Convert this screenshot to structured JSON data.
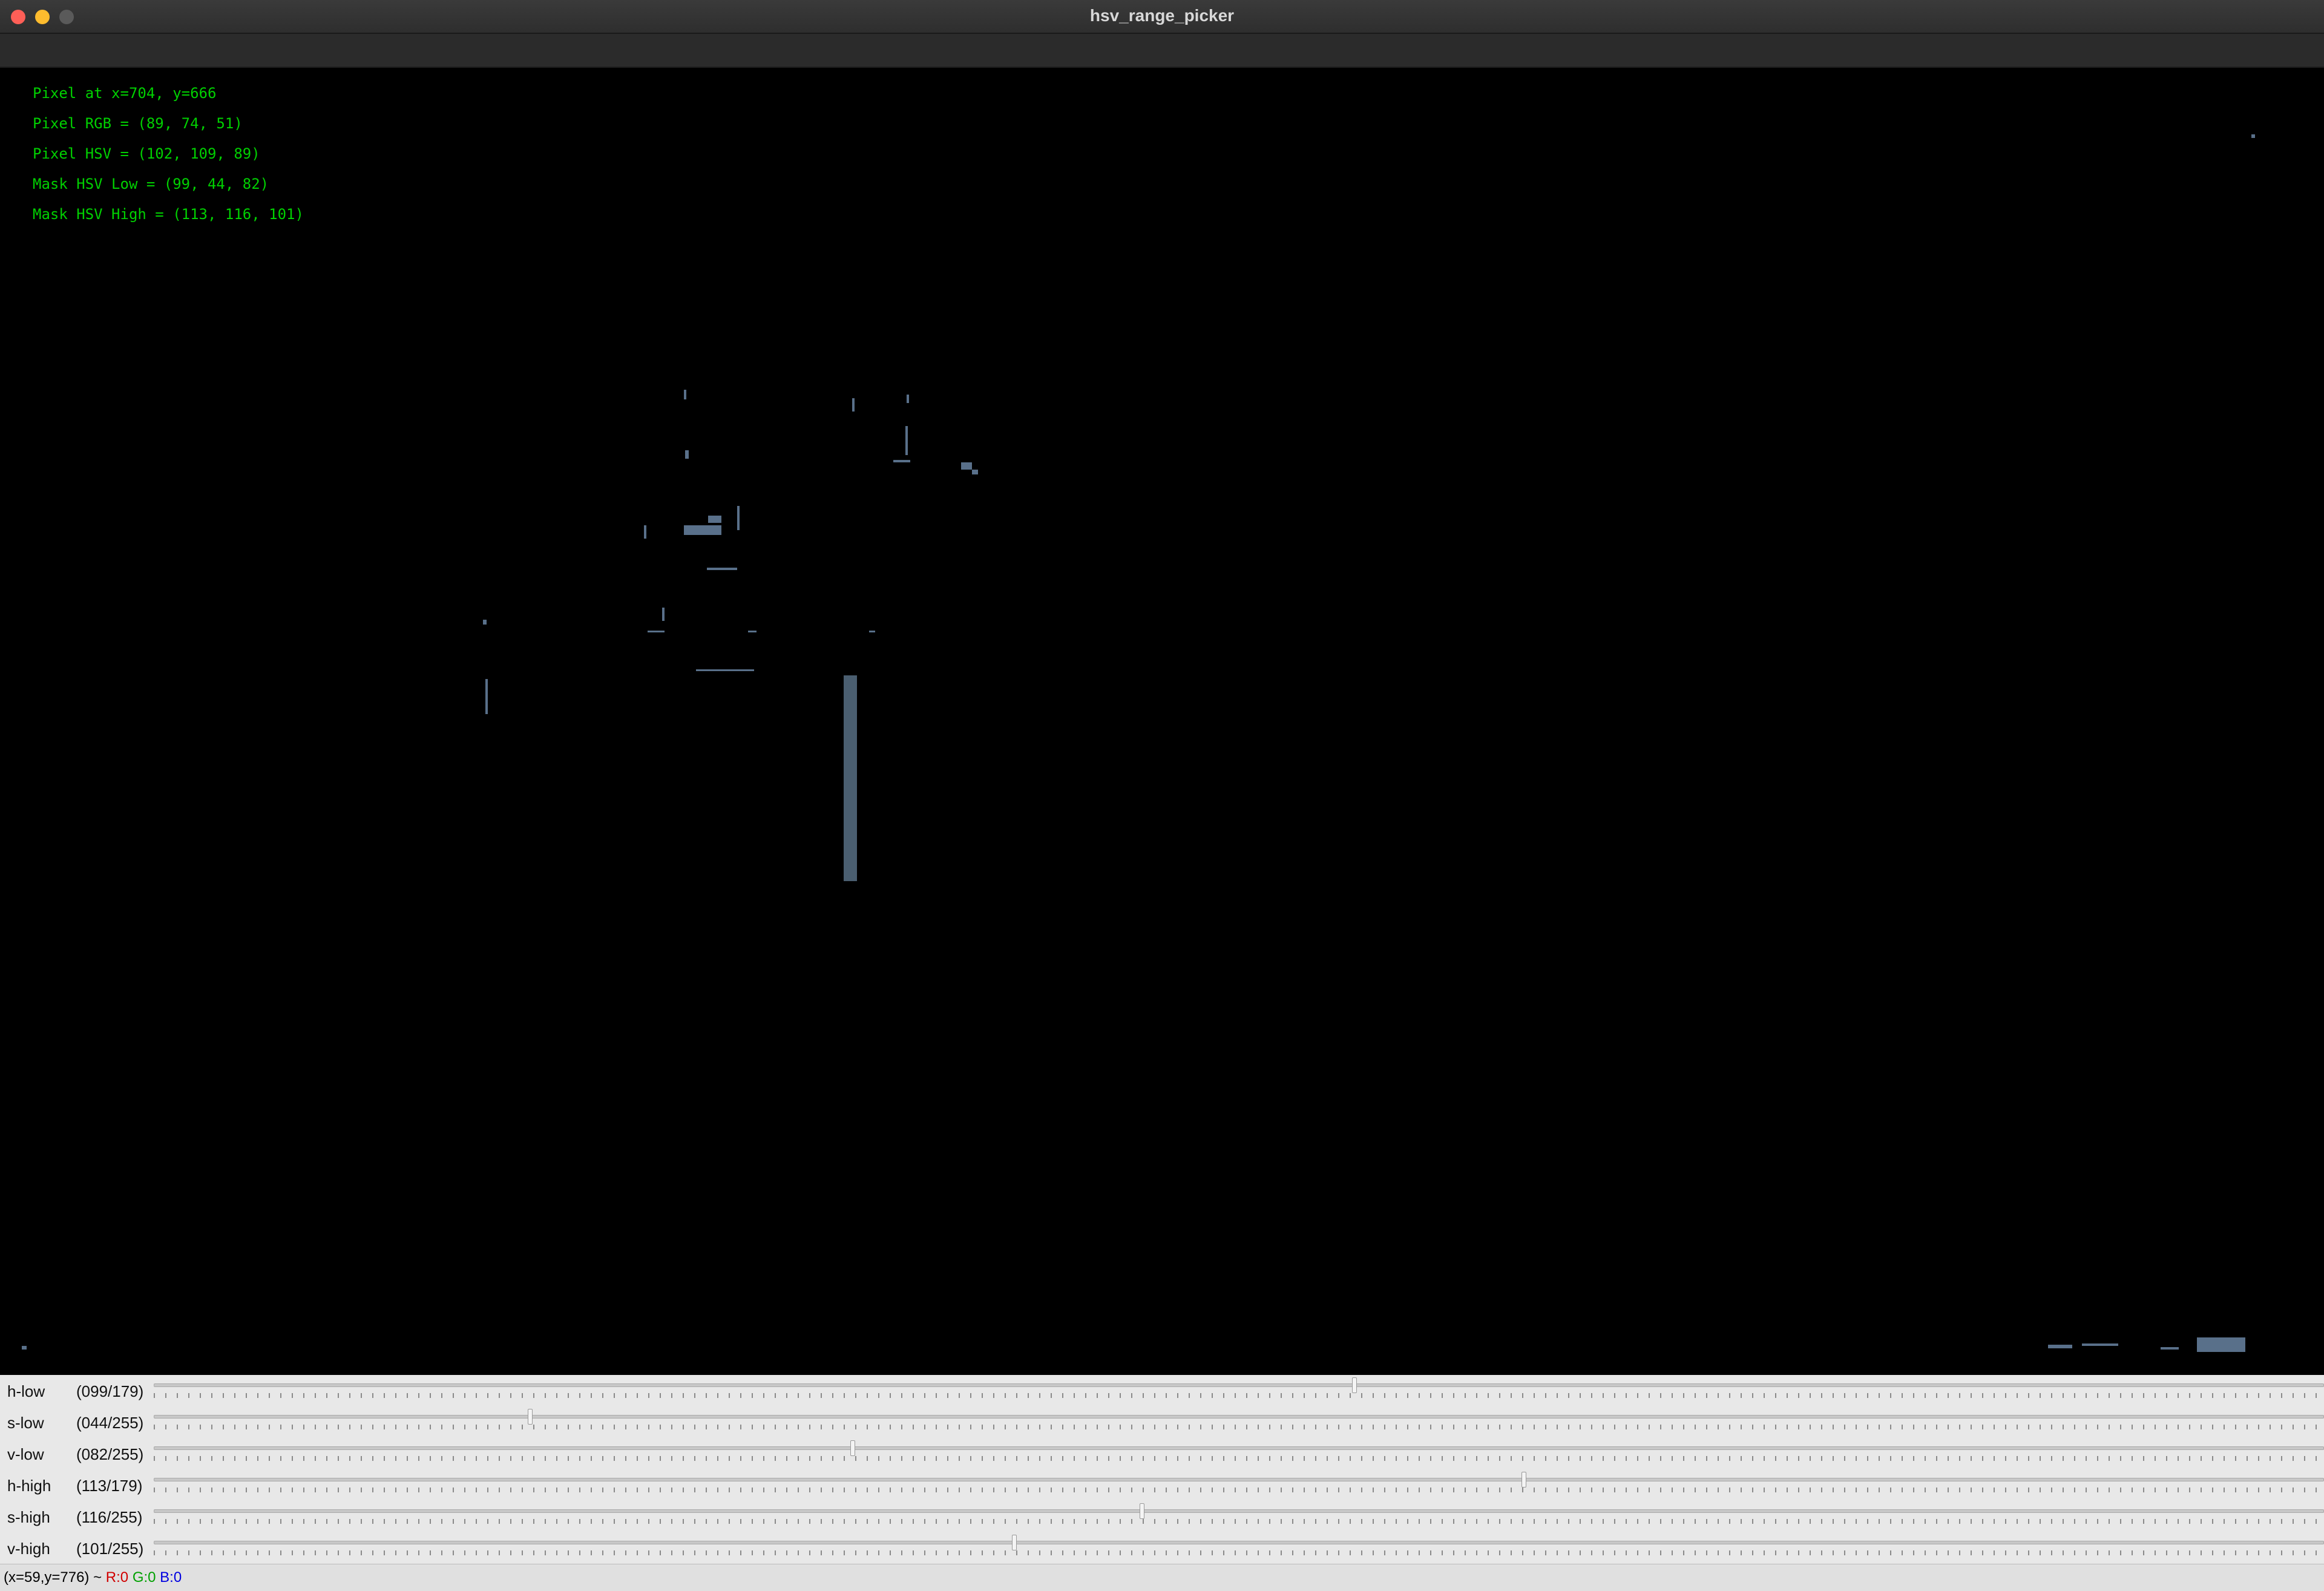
{
  "window": {
    "title": "hsv_range_picker"
  },
  "overlay": {
    "lines": [
      "Pixel at x=704, y=666",
      "Pixel RGB = (89, 74, 51)",
      "Pixel HSV = (102, 109, 89)",
      "Mask HSV Low = (99, 44, 82)",
      "Mask HSV High = (113, 116, 101)"
    ],
    "color": "#00d000"
  },
  "sliders": [
    {
      "name": "h-low",
      "label": "h-low",
      "value_text": "(099/179)",
      "value": 99,
      "max": 179
    },
    {
      "name": "s-low",
      "label": "s-low",
      "value_text": "(044/255)",
      "value": 44,
      "max": 255
    },
    {
      "name": "v-low",
      "label": "v-low",
      "value_text": "(082/255)",
      "value": 82,
      "max": 255
    },
    {
      "name": "h-high",
      "label": "h-high",
      "value_text": "(113/179)",
      "value": 113,
      "max": 179
    },
    {
      "name": "s-high",
      "label": "s-high",
      "value_text": "(116/255)",
      "value": 116,
      "max": 255
    },
    {
      "name": "v-high",
      "label": "v-high",
      "value_text": "(101/255)",
      "value": 101,
      "max": 255
    }
  ],
  "status": {
    "coords": "(x=59,y=776) ~",
    "r": "R:0",
    "g": "G:0",
    "b": "B:0"
  }
}
